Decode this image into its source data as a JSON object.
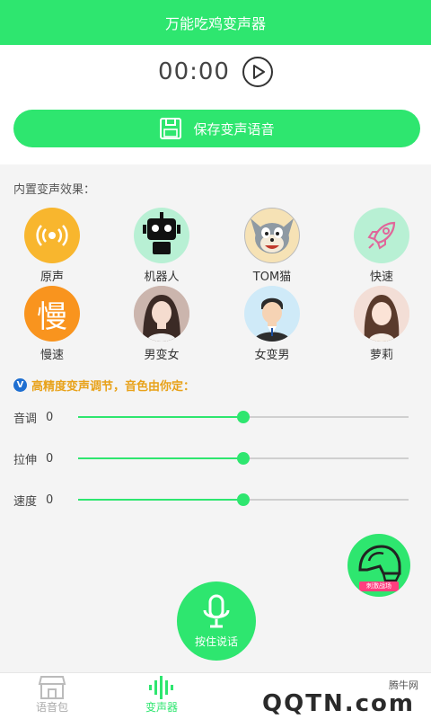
{
  "app": {
    "title": "万能吃鸡变声器"
  },
  "player": {
    "time": "00:00"
  },
  "save_button": {
    "label": "保存变声语音"
  },
  "effects_section": {
    "title": "内置变声效果：",
    "items": [
      {
        "label": "原声",
        "icon": "broadcast-icon",
        "bg": "#f8b62e"
      },
      {
        "label": "机器人",
        "icon": "robot-icon",
        "bg": "#b8f0d4"
      },
      {
        "label": "TOM猫",
        "icon": "tom-cat-icon",
        "bg": "#f6e2b5"
      },
      {
        "label": "快速",
        "icon": "rocket-icon",
        "bg": "#b8f0d4"
      },
      {
        "label": "慢速",
        "icon": "slow-char-icon",
        "glyph": "慢",
        "bg": "#f9941e"
      },
      {
        "label": "男变女",
        "icon": "female-avatar-icon",
        "bg": "#d9c3bd"
      },
      {
        "label": "女变男",
        "icon": "male-avatar-icon",
        "bg": "#cfeaf8"
      },
      {
        "label": "萝莉",
        "icon": "girl-avatar-icon",
        "bg": "#f2d7cf"
      }
    ]
  },
  "tuning": {
    "badge": "V",
    "title": "高精度变声调节，音色由你定：",
    "sliders": [
      {
        "label": "音调",
        "value": "0",
        "level": 0.5
      },
      {
        "label": "拉伸",
        "value": "0",
        "level": 0.5
      },
      {
        "label": "速度",
        "value": "0",
        "level": 0.5
      }
    ]
  },
  "helmet_button": {
    "tag": "刺激战场"
  },
  "mic_button": {
    "label": "按住说话"
  },
  "nav": {
    "items": [
      {
        "label": "语音包",
        "icon": "shop-icon",
        "active": false
      },
      {
        "label": "变声器",
        "icon": "soundwave-icon",
        "active": true
      }
    ]
  },
  "watermark": {
    "top": "腾牛网",
    "main": "QQTN.com"
  },
  "colors": {
    "accent": "#2ee66f",
    "highlight": "#e8a21a",
    "badge": "#1f6fd1"
  }
}
